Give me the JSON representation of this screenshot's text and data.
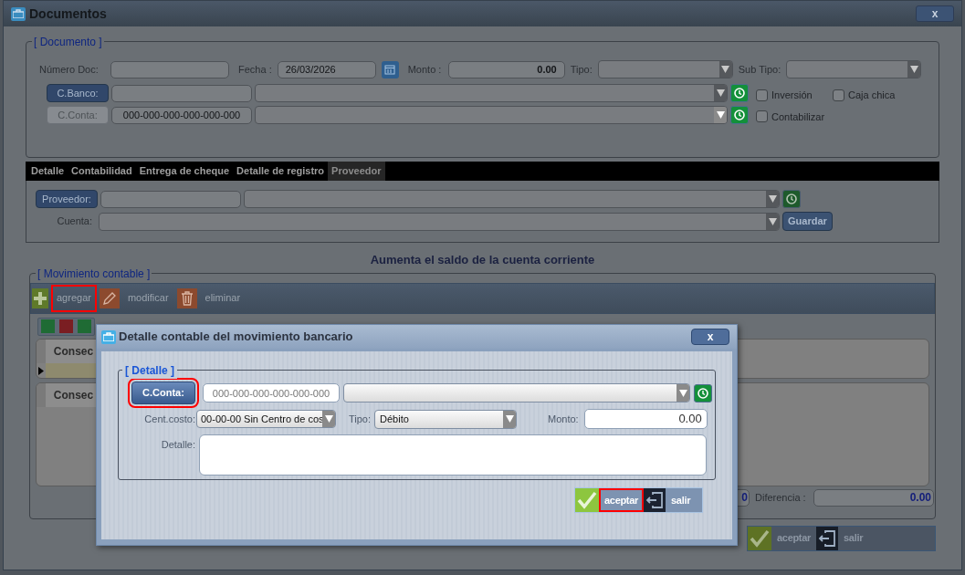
{
  "window": {
    "title": "Documentos",
    "close": "x"
  },
  "documento": {
    "legend": "[ Documento ]",
    "numero_doc": {
      "label": "Número Doc:"
    },
    "fecha": {
      "label": "Fecha :",
      "value": "26/03/2026"
    },
    "monto": {
      "label": "Monto :",
      "value": "0.00"
    },
    "tipo": {
      "label": "Tipo:"
    },
    "sub_tipo": {
      "label": "Sub Tipo:"
    },
    "c_banco": {
      "label": "C.Banco:",
      "disabled": false
    },
    "c_conta": {
      "label": "C.Conta:",
      "value": "000-000-000-000-000-000",
      "disabled": true
    },
    "checkboxes": [
      {
        "label": "Inversión",
        "checked": false
      },
      {
        "label": "Caja chica",
        "checked": false
      },
      {
        "label": "Contabilizar",
        "checked": false
      }
    ]
  },
  "tabs": [
    {
      "label": "Detalle",
      "selected": false
    },
    {
      "label": "Contabilidad",
      "selected": false
    },
    {
      "label": "Entrega de cheque",
      "selected": false
    },
    {
      "label": "Detalle de registro",
      "selected": false
    },
    {
      "label": "Proveedor",
      "selected": true
    }
  ],
  "proveedor": {
    "button": "Proveedor:",
    "cuenta_label": "Cuenta:",
    "save": "Guardar"
  },
  "note": "Aumenta el saldo de la cuenta corriente",
  "movimiento": {
    "legend": "[ Movimiento contable ]",
    "toolbar": [
      {
        "label": "agregar",
        "kind": "add",
        "highlighted": true
      },
      {
        "label": "modificar",
        "kind": "edit",
        "highlighted": false
      },
      {
        "label": "eliminar",
        "kind": "delete",
        "highlighted": false
      }
    ],
    "grids": [
      {
        "column_1": "Consec"
      },
      {
        "column_1": "Consec"
      }
    ],
    "total_value": "0",
    "diferencia": {
      "label": "Diferencia :",
      "value": "0.00"
    }
  },
  "footer_buttons": [
    {
      "label": "aceptar",
      "kind": "accept",
      "highlighted": false
    },
    {
      "label": "salir",
      "kind": "exit",
      "highlighted": false
    }
  ],
  "dialog": {
    "title": "Detalle contable del movimiento bancario",
    "close": "x",
    "legend": "[ Detalle ]",
    "c_conta": {
      "label": "C.Conta:",
      "highlighted": true
    },
    "account": {
      "placeholder": "000-000-000-000-000-000"
    },
    "centro": {
      "label": "Cent.costo:",
      "value": "00-00-00 Sin Centro de cos"
    },
    "tipo": {
      "label": "Tipo:",
      "value": "Débito"
    },
    "monto": {
      "label": "Monto:",
      "value": "0.00"
    },
    "detalle": {
      "label": "Detalle:"
    },
    "buttons": [
      {
        "label": "aceptar",
        "kind": "accept",
        "highlighted": true
      },
      {
        "label": "salir",
        "kind": "exit",
        "highlighted": false
      }
    ]
  }
}
